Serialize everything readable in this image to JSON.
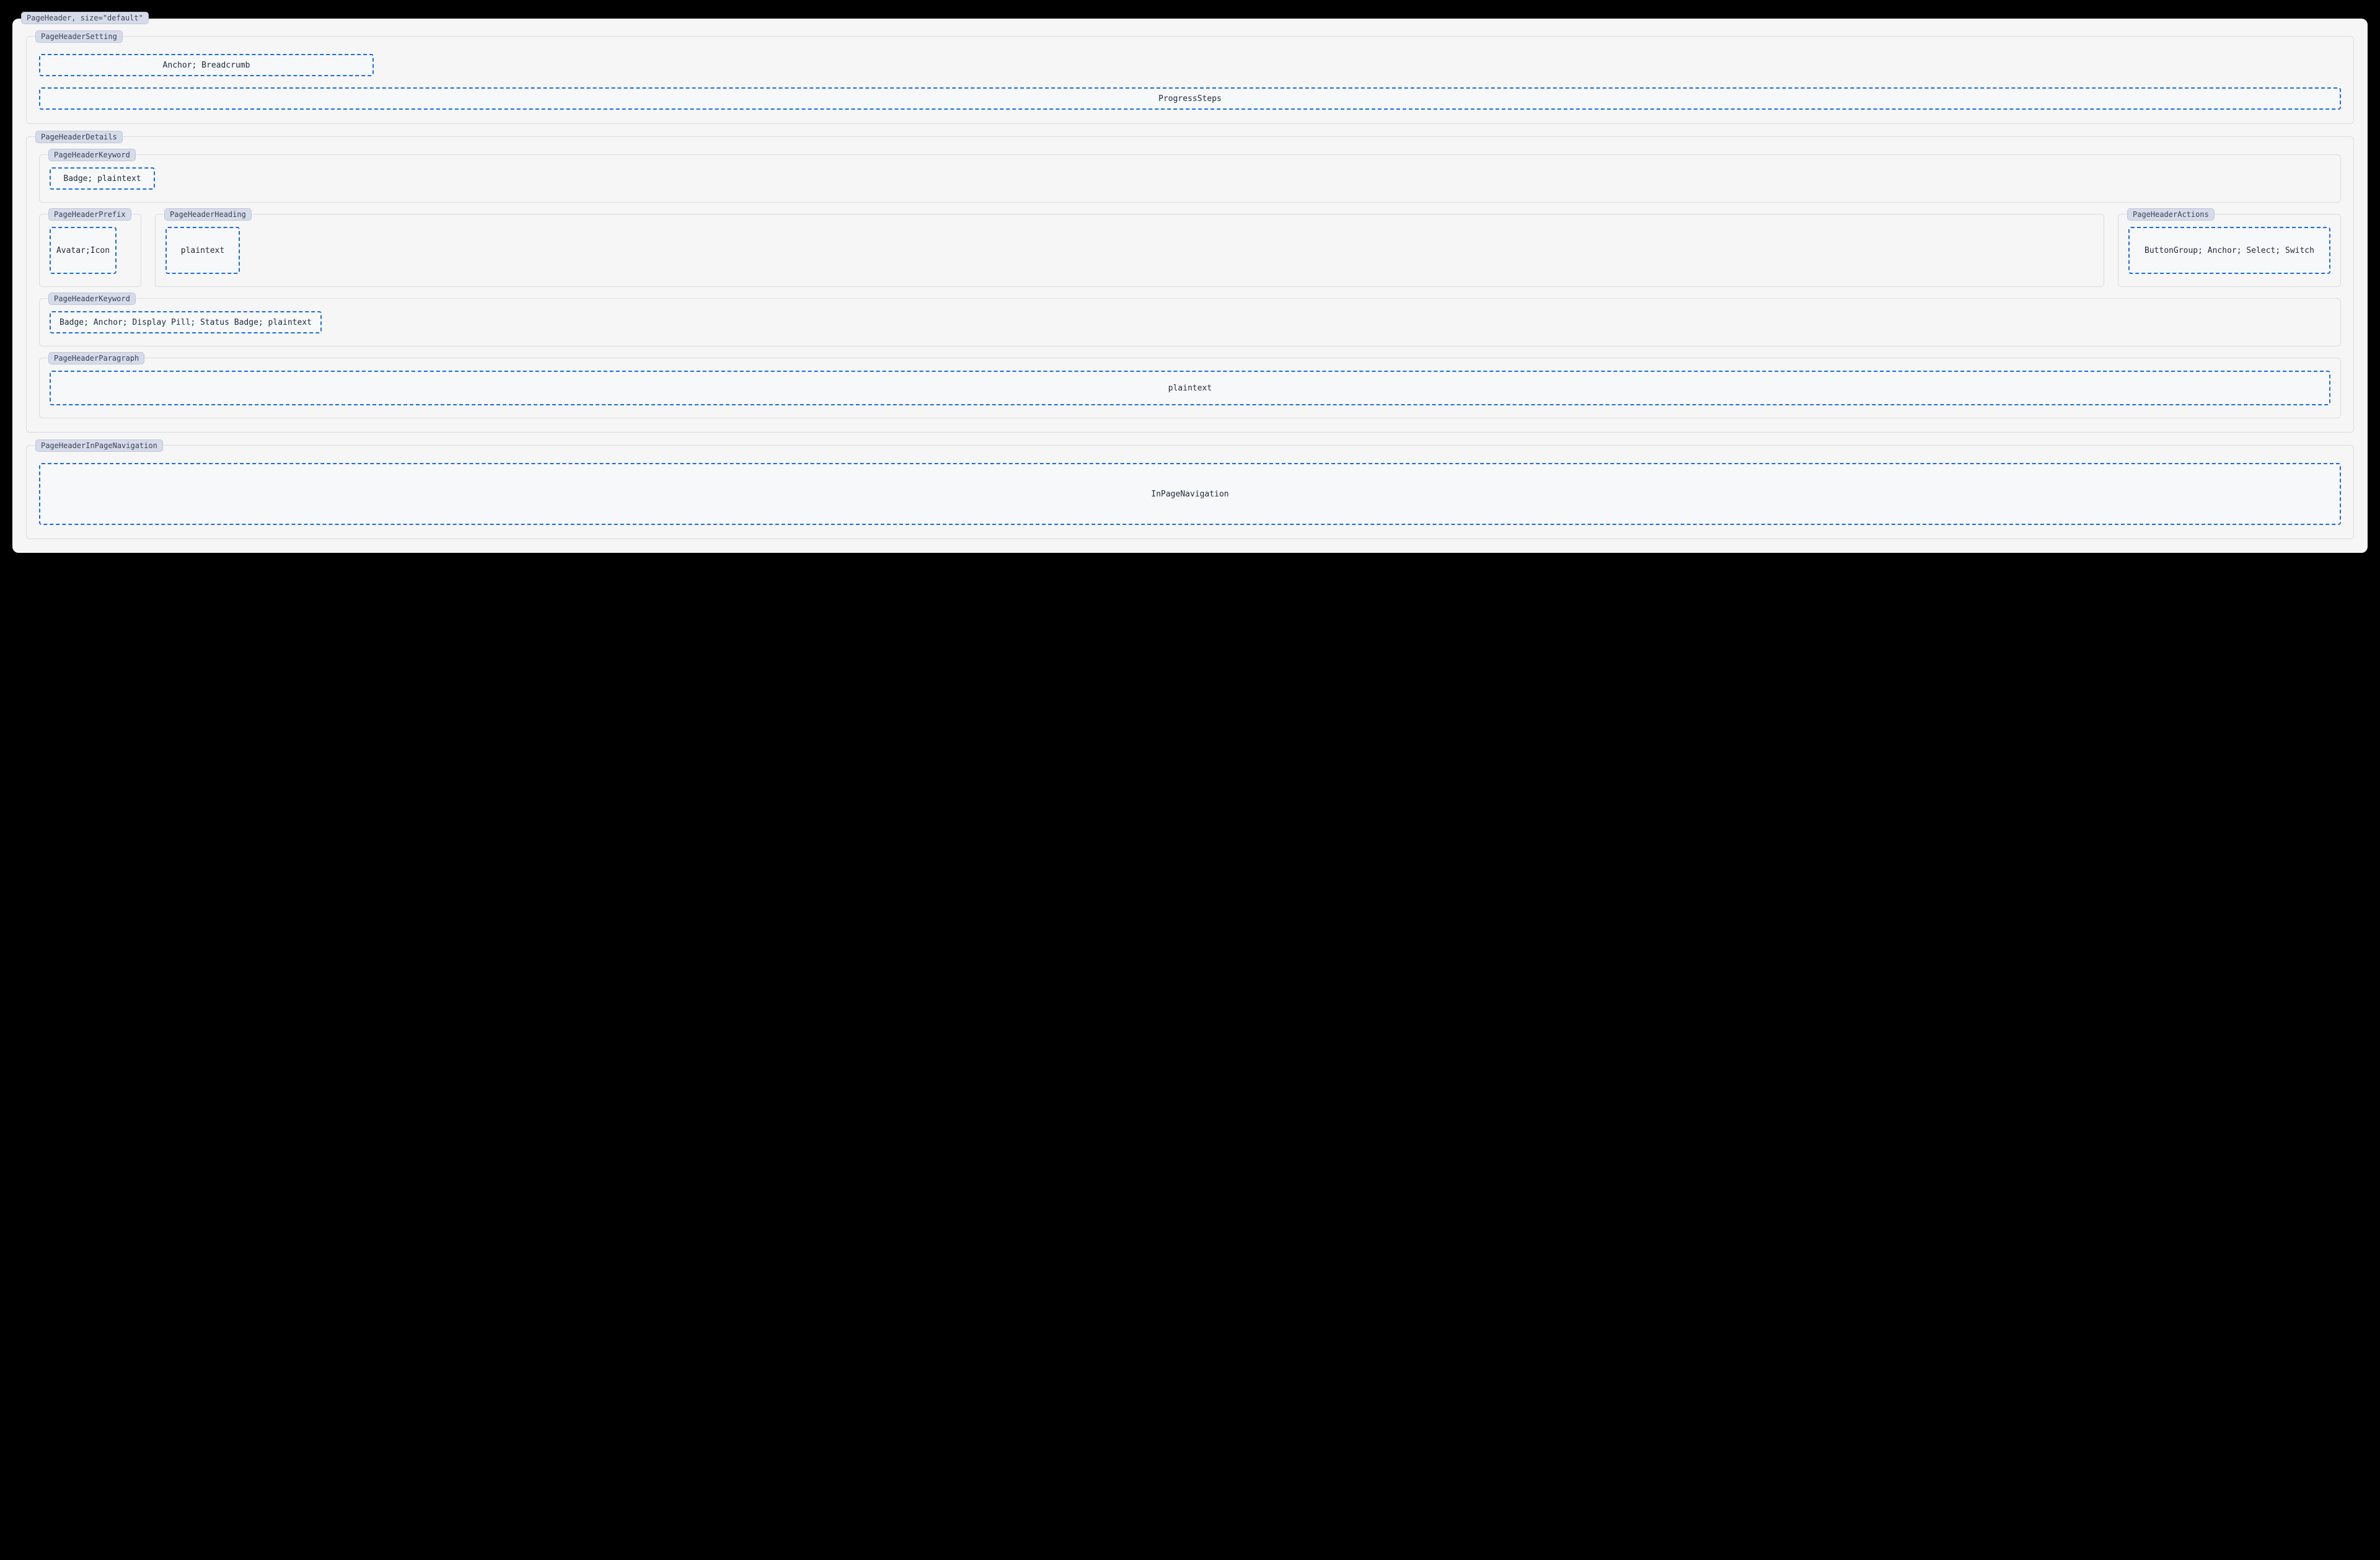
{
  "root": {
    "label": "PageHeader, size=\"default\""
  },
  "setting": {
    "label": "PageHeaderSetting",
    "breadcrumb_slot": "Anchor; Breadcrumb",
    "progress_slot": "ProgressSteps"
  },
  "details": {
    "label": "PageHeaderDetails",
    "keyword_top": {
      "label": "PageHeaderKeyword",
      "slot": "Badge; plaintext"
    },
    "prefix": {
      "label": "PageHeaderPrefix",
      "slot": "Avatar;Icon"
    },
    "heading": {
      "label": "PageHeaderHeading",
      "slot": "plaintext"
    },
    "actions": {
      "label": "PageHeaderActions",
      "slot": "ButtonGroup; Anchor; Select; Switch"
    },
    "keyword_bottom": {
      "label": "PageHeaderKeyword",
      "slot": "Badge; Anchor; Display Pill; Status Badge; plaintext"
    },
    "paragraph": {
      "label": "PageHeaderParagraph",
      "slot": "plaintext"
    }
  },
  "inpage": {
    "label": "PageHeaderInPageNavigation",
    "slot": "InPageNavigation"
  }
}
